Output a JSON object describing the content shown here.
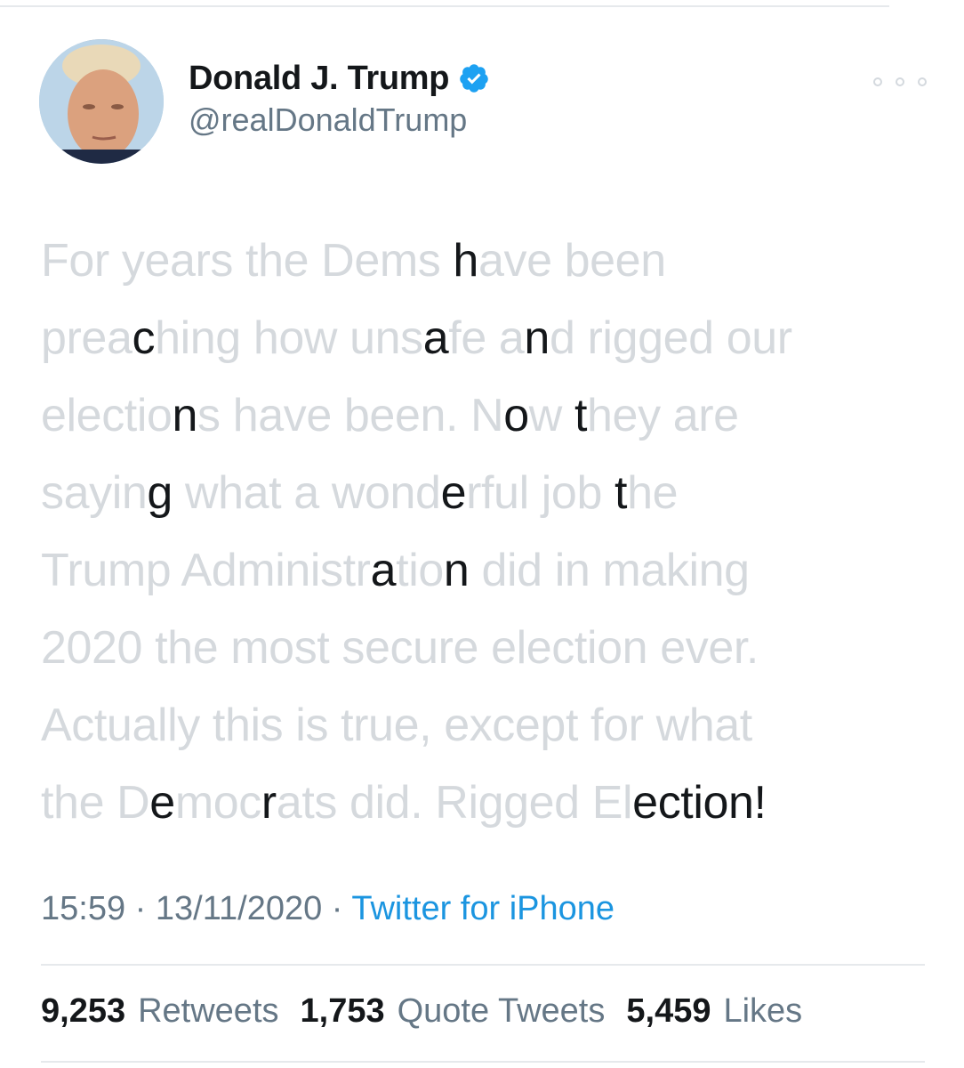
{
  "author": {
    "display_name": "Donald J. Trump",
    "handle": "@realDonaldTrump",
    "verified": true,
    "verified_color": "#1da1f2"
  },
  "tweet": {
    "lines": [
      [
        {
          "t": "For years the Dems ",
          "d": false
        },
        {
          "t": "h",
          "d": true
        },
        {
          "t": "ave been",
          "d": false
        }
      ],
      [
        {
          "t": "prea",
          "d": false
        },
        {
          "t": "c",
          "d": true
        },
        {
          "t": "hing how uns",
          "d": false
        },
        {
          "t": "a",
          "d": true
        },
        {
          "t": "fe a",
          "d": false
        },
        {
          "t": "n",
          "d": true
        },
        {
          "t": "d rigged our",
          "d": false
        }
      ],
      [
        {
          "t": "electio",
          "d": false
        },
        {
          "t": "n",
          "d": true
        },
        {
          "t": "s have been. N",
          "d": false
        },
        {
          "t": "o",
          "d": true
        },
        {
          "t": "w ",
          "d": false
        },
        {
          "t": "t",
          "d": true
        },
        {
          "t": "hey are",
          "d": false
        }
      ],
      [
        {
          "t": "sayin",
          "d": false
        },
        {
          "t": "g",
          "d": true
        },
        {
          "t": " what a wond",
          "d": false
        },
        {
          "t": "e",
          "d": true
        },
        {
          "t": "rful job ",
          "d": false
        },
        {
          "t": "t",
          "d": true
        },
        {
          "t": "he",
          "d": false
        }
      ],
      [
        {
          "t": "Trump Administr",
          "d": false
        },
        {
          "t": "a",
          "d": true
        },
        {
          "t": "tio",
          "d": false
        },
        {
          "t": "n",
          "d": true
        },
        {
          "t": " did in making",
          "d": false
        }
      ],
      [
        {
          "t": "2020 the most secure election ever.",
          "d": false
        }
      ],
      [
        {
          "t": "Actually this is true, except for what",
          "d": false
        }
      ],
      [
        {
          "t": "the D",
          "d": false
        },
        {
          "t": "e",
          "d": true
        },
        {
          "t": "moc",
          "d": false
        },
        {
          "t": "r",
          "d": true
        },
        {
          "t": "ats did. Rigged El",
          "d": false
        },
        {
          "t": "ection!",
          "d": true
        }
      ]
    ]
  },
  "meta": {
    "time": "15:59",
    "separator": " · ",
    "date": "13/11/2020",
    "source": "Twitter for iPhone"
  },
  "stats": {
    "retweets_count": "9,253",
    "retweets_label": "Retweets",
    "quotes_count": "1,753",
    "quotes_label": "Quote Tweets",
    "likes_count": "5,459",
    "likes_label": "Likes"
  },
  "icons": {
    "verified": "verified-badge-icon",
    "more": "more-options-icon"
  }
}
